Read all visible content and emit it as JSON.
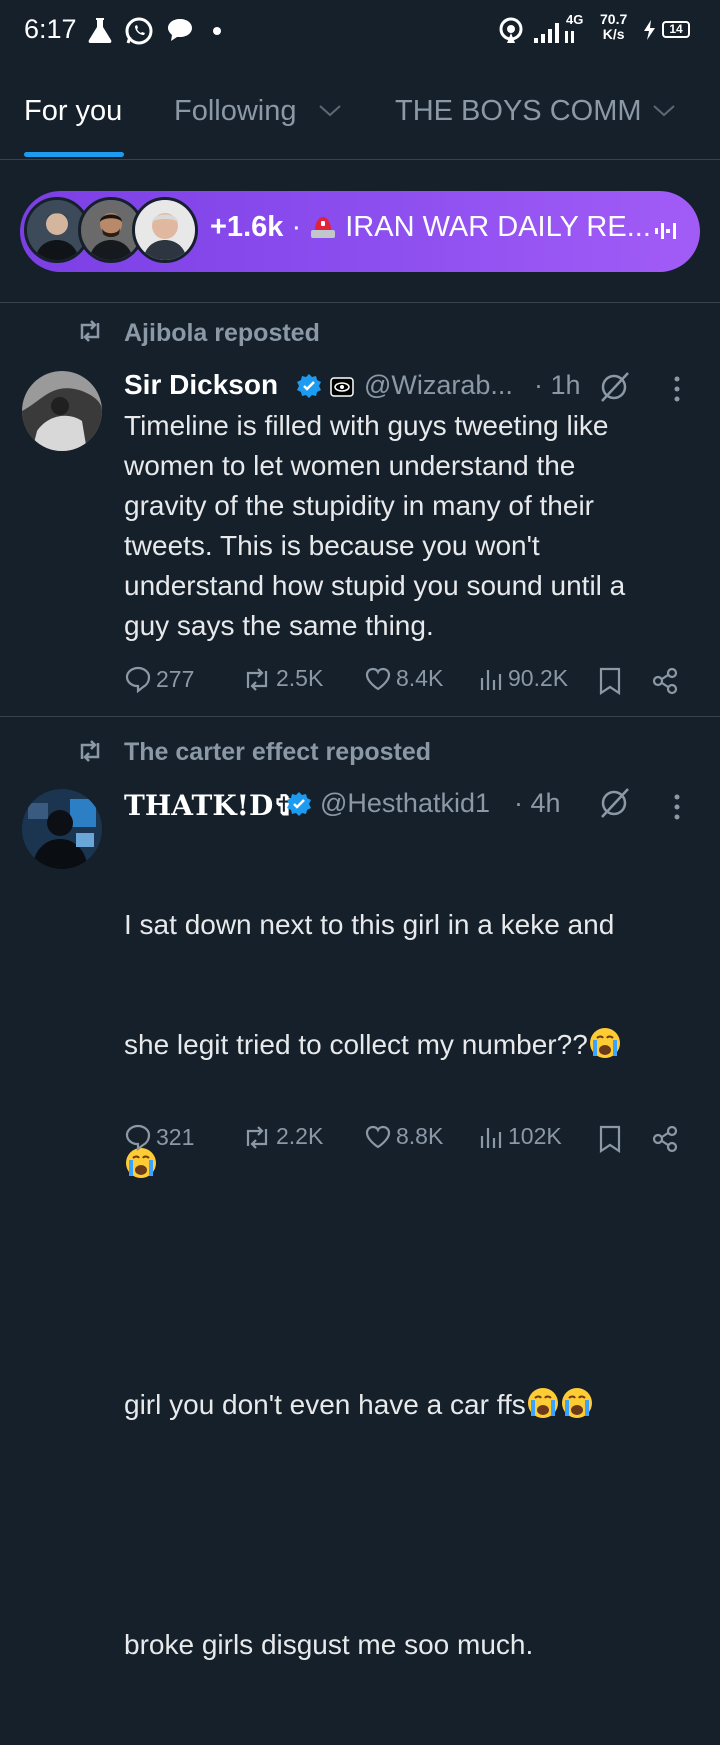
{
  "status_bar": {
    "time": "6:17",
    "net_speed_value": "70.7",
    "net_speed_unit": "K/s",
    "network_type": "4G",
    "battery": "14",
    "icons": [
      "flask-icon",
      "whatsapp-icon",
      "chat-bubble-icon",
      "dot-icon",
      "hotspot-icon",
      "signal-icon",
      "charging-icon",
      "battery-icon"
    ]
  },
  "tabs": [
    {
      "label": "For you",
      "active": true
    },
    {
      "label": "Following",
      "active": false
    },
    {
      "label": "THE BOYS COMM",
      "active": false
    }
  ],
  "spaces": {
    "count": "+1.6k",
    "separator": "·",
    "title": "IRAN WAR DAILY RE...",
    "icons": [
      "siren-icon",
      "audio-wave-icon"
    ]
  },
  "tweets": [
    {
      "repost_label": "Ajibola reposted",
      "name": "Sir Dickson",
      "handle": "@Wizarab...",
      "time": "· 1h",
      "text": "Timeline is filled with guys tweeting like\nwomen to let women understand the\ngravity of the stupidity in many of their\ntweets. This is because you won't\nunderstand how stupid you sound until a\nguy says the same thing.",
      "replies": "277",
      "reposts": "2.5K",
      "likes": "8.4K",
      "views": "90.2K"
    },
    {
      "repost_label": "The carter effect reposted",
      "name": "THATK!D✞",
      "handle": "@Hesthatkid1",
      "time": "· 4h",
      "text_line1": "I sat down next to this girl in a keke and",
      "text_line2": "she legit tried to collect my number??",
      "text_line3": "girl you don't even have a car ffs",
      "text_line4": "broke girls disgust me soo much.",
      "replies": "321",
      "reposts": "2.2K",
      "likes": "8.8K",
      "views": "102K"
    }
  ],
  "colors": {
    "background": "#15202b",
    "accent": "#1d9bf0",
    "muted": "#8b98a5",
    "pill": "#8e4ff0",
    "divider": "#38444d"
  }
}
